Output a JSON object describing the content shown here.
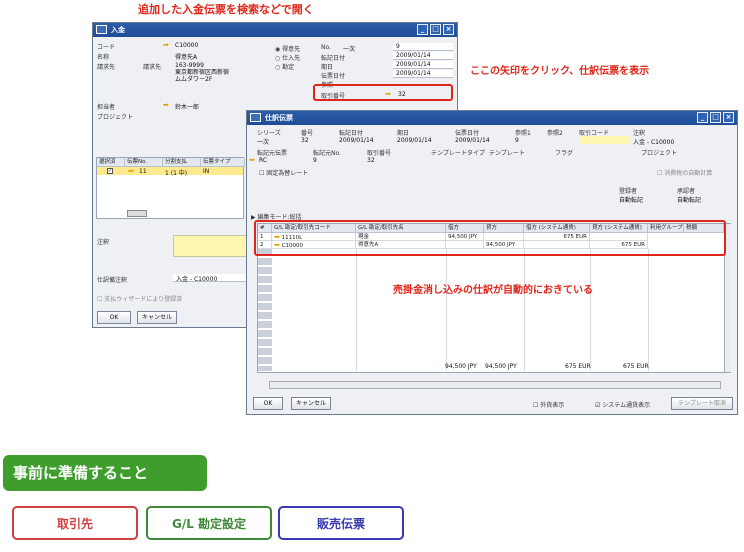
{
  "top_note": "追加した入金伝票を検索などで開く",
  "side_note": "ここの矢印をクリック、仕訳伝票を表示",
  "mid_note": "売掛金消し込みの仕訳が自動的におきている",
  "payment_window": {
    "title": "入金",
    "labels": {
      "code": "コード",
      "name": "名称",
      "bill_to": "請求先",
      "bill_to_sub": "請求先",
      "owner": "担当者",
      "project": "プロジェクト",
      "journal": "注釈",
      "journal_remarks": "仕訳備注釈",
      "no": "No.",
      "post_date": "転記日付",
      "due_date": "期日",
      "doc_date": "伝票日付",
      "ref": "参照",
      "trans_no": "取引番号"
    },
    "values": {
      "code": "C10000",
      "name": "得意先A",
      "address": "163-9999\n東京都新宿区西新宿\nムムダワー2F",
      "owner": "鈴木一郎",
      "series": "一次",
      "no": "9",
      "post_date": "2009/01/14",
      "due_date": "2009/01/14",
      "doc_date": "2009/01/14",
      "trans_no": "32",
      "journal_remarks": "入金 - C10000"
    },
    "radios": [
      "得意先",
      "仕入先",
      "勘定"
    ],
    "grid_headers": [
      "選択済",
      "伝票No.",
      "分割支払",
      "伝票タイプ"
    ],
    "grid_row": {
      "no": "11",
      "split": "1 (1 中)",
      "type": "IN"
    },
    "checkbox_label": "支払ウィザードにより登録済",
    "ok": "OK",
    "cancel": "キャンセル"
  },
  "journal_window": {
    "title": "仕訳伝票",
    "header_labels": [
      "シリーズ",
      "番号",
      "転記日付",
      "期日",
      "伝票日付",
      "参照1",
      "参照2",
      "取引コード",
      "注釈"
    ],
    "header_values": [
      "一次",
      "32",
      "2009/01/14",
      "2009/01/14",
      "2009/01/14",
      "9",
      "",
      "",
      "入金 - C10000"
    ],
    "header2_labels": [
      "転記元伝票",
      "転記元No.",
      "取引番号",
      "テンプレートタイプ",
      "テンプレート",
      "フラグ",
      "プロジェクト"
    ],
    "header2_values": [
      "RC",
      "9",
      "32"
    ],
    "fixed_rate": "固定為替レート",
    "tax_calc": "消費税の自動計算",
    "creator_label": "登録者",
    "creator_value": "自動転記",
    "approver_label": "承認者",
    "approver_value": "自動転記",
    "edit_mode": "編集モード:総括",
    "columns": [
      "#",
      "G/L 勘定/取引先コード",
      "G/L 勘定/取引先名",
      "借方",
      "貸方",
      "借方 (システム通貨)",
      "貸方 (システム通貨)",
      "利用グループ",
      "税額"
    ],
    "rows": [
      {
        "num": "1",
        "code": "11110L",
        "name": "現金",
        "debit": "94,500 JPY",
        "credit": "",
        "debit_sc": "675 EUR",
        "credit_sc": ""
      },
      {
        "num": "2",
        "code": "C10000",
        "name": "得意先A",
        "debit": "",
        "credit": "94,500 JPY",
        "debit_sc": "",
        "credit_sc": "675 EUR"
      }
    ],
    "totals": [
      "94,500 JPY",
      "94,500 JPY",
      "675 EUR",
      "675 EUR"
    ],
    "ok": "OK",
    "cancel": "キャンセル",
    "foreign_currency": "外貨表示",
    "system_currency": "システム通貨表示",
    "template_btn": "テンプレート取消"
  },
  "prep": {
    "heading": "事前に準備すること",
    "steps": [
      "取引先",
      "G/L 勘定設定",
      "販売伝票"
    ],
    "colors": {
      "heading": "#3f9d2e",
      "step1": "#d04040",
      "step2": "#3f8a3a",
      "step3": "#3a3ab0"
    }
  }
}
